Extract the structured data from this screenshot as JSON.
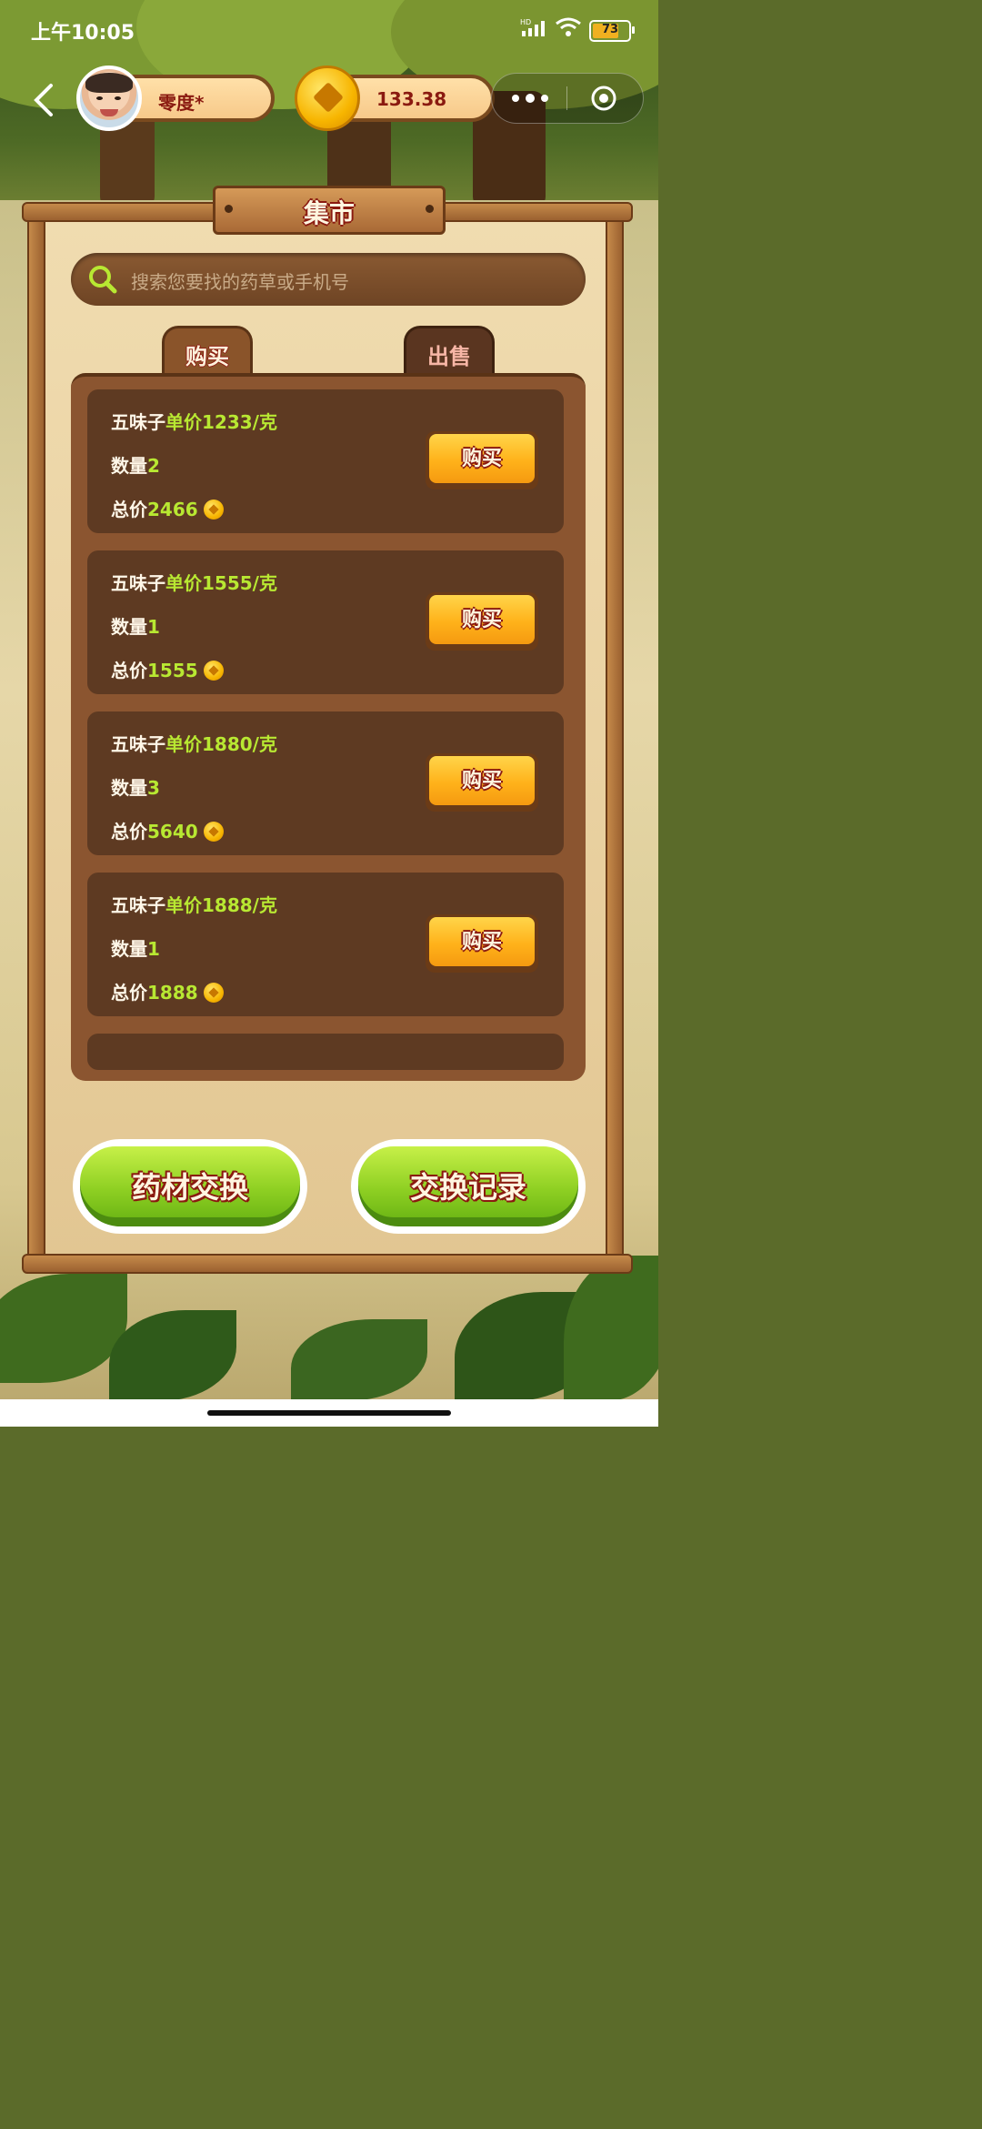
{
  "status_bar": {
    "time": "上午10:05",
    "battery": "73",
    "network": "HD"
  },
  "header": {
    "user_name": "零度*",
    "coin_balance": "133.38"
  },
  "board": {
    "title": "集市"
  },
  "search": {
    "placeholder": "搜索您要找的药草或手机号"
  },
  "tabs": [
    {
      "label": "购买",
      "active": true
    },
    {
      "label": "出售",
      "active": false
    }
  ],
  "listings": [
    {
      "name": "五味子",
      "unit_price_label": "单价1233/克",
      "qty_label": "数量",
      "qty": "2",
      "total_label": "总价",
      "total": "2466",
      "button": "购买"
    },
    {
      "name": "五味子",
      "unit_price_label": "单价1555/克",
      "qty_label": "数量",
      "qty": "1",
      "total_label": "总价",
      "total": "1555",
      "button": "购买"
    },
    {
      "name": "五味子",
      "unit_price_label": "单价1880/克",
      "qty_label": "数量",
      "qty": "3",
      "total_label": "总价",
      "total": "5640",
      "button": "购买"
    },
    {
      "name": "五味子",
      "unit_price_label": "单价1888/克",
      "qty_label": "数量",
      "qty": "1",
      "total_label": "总价",
      "total": "1888",
      "button": "购买"
    }
  ],
  "bottom_buttons": {
    "exchange": "药材交换",
    "records": "交换记录"
  },
  "colors": {
    "highlight": "#b8e832",
    "panel": "#8b5530",
    "card": "#5e3a22",
    "title_outline": "#8a1a10"
  }
}
